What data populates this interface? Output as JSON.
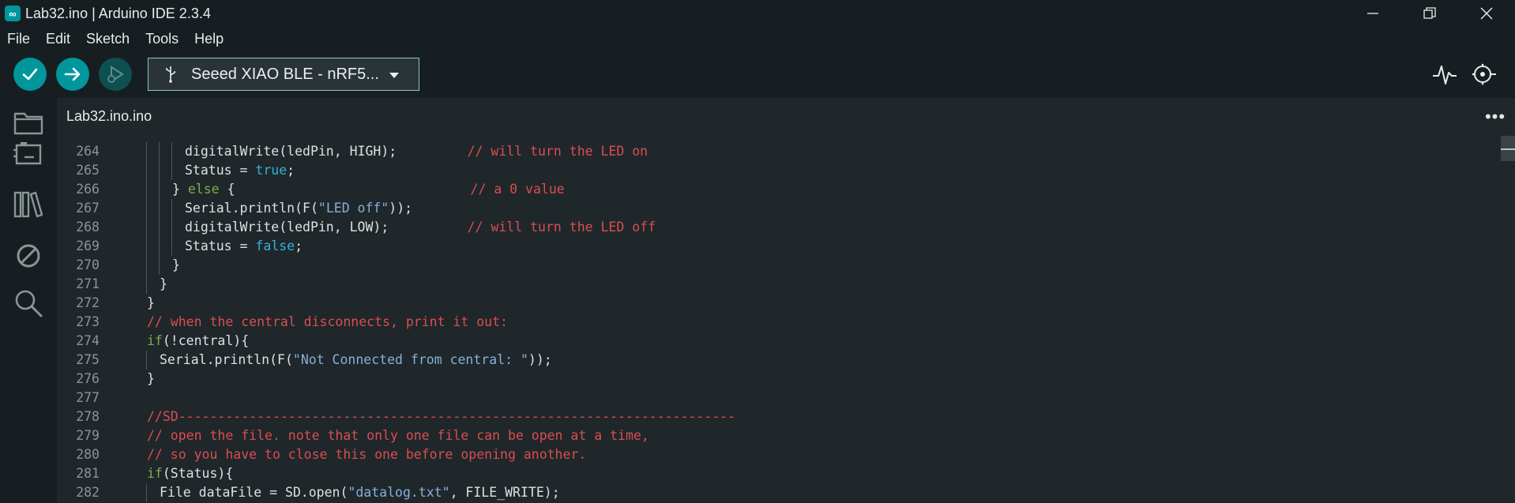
{
  "window": {
    "title": "Lab32.ino | Arduino IDE 2.3.4",
    "app_icon": "arduino-infinity-icon",
    "controls": [
      "minimize",
      "maximize",
      "close"
    ]
  },
  "menu": {
    "items": [
      "File",
      "Edit",
      "Sketch",
      "Tools",
      "Help"
    ]
  },
  "toolbar": {
    "verify_icon": "check-icon",
    "upload_icon": "arrow-right-icon",
    "debug_icon": "debug-icon",
    "board_label": "Seeed XIAO BLE - nRF5...",
    "board_icon": "usb-icon",
    "serial_plotter_icon": "plotter-icon",
    "serial_monitor_icon": "serial-monitor-icon",
    "accent_color": "#00979c"
  },
  "activity_bar": {
    "items": [
      "folder-icon",
      "board-manager-icon",
      "library-icon",
      "debug-disabled-icon",
      "search-icon"
    ]
  },
  "editor": {
    "tab_label": "Lab32.ino.ino",
    "more_label": "•••",
    "lines": [
      {
        "n": "264",
        "indent": 3,
        "parts": [
          [
            "",
            "digitalWrite(ledPin, HIGH);         "
          ],
          [
            "tk-comment",
            "// will turn the LED on"
          ]
        ]
      },
      {
        "n": "265",
        "indent": 3,
        "parts": [
          [
            "",
            "Status = "
          ],
          [
            "tk-const",
            "true"
          ],
          [
            "",
            ";"
          ]
        ]
      },
      {
        "n": "266",
        "indent": 2,
        "parts": [
          [
            "",
            "} "
          ],
          [
            "tk-kw",
            "else"
          ],
          [
            "",
            " {                              "
          ],
          [
            "tk-comment",
            "// a 0 value"
          ]
        ]
      },
      {
        "n": "267",
        "indent": 3,
        "parts": [
          [
            "",
            "Serial.println(F("
          ],
          [
            "tk-str",
            "\"LED off\""
          ],
          [
            "",
            "));"
          ]
        ]
      },
      {
        "n": "268",
        "indent": 3,
        "parts": [
          [
            "",
            "digitalWrite(ledPin, LOW);          "
          ],
          [
            "tk-comment",
            "// will turn the LED off"
          ]
        ]
      },
      {
        "n": "269",
        "indent": 3,
        "parts": [
          [
            "",
            "Status = "
          ],
          [
            "tk-const",
            "false"
          ],
          [
            "",
            ";"
          ]
        ]
      },
      {
        "n": "270",
        "indent": 2,
        "parts": [
          [
            "",
            "}"
          ]
        ]
      },
      {
        "n": "271",
        "indent": 1,
        "parts": [
          [
            "",
            "}"
          ]
        ]
      },
      {
        "n": "272",
        "indent": 0,
        "parts": [
          [
            "",
            "}"
          ]
        ]
      },
      {
        "n": "273",
        "indent": 0,
        "parts": [
          [
            "tk-comment",
            "// when the central disconnects, print it out:"
          ]
        ]
      },
      {
        "n": "274",
        "indent": 0,
        "parts": [
          [
            "tk-kw",
            "if"
          ],
          [
            "",
            "(!central){"
          ]
        ]
      },
      {
        "n": "275",
        "indent": 1,
        "parts": [
          [
            "",
            "Serial.println(F("
          ],
          [
            "tk-str",
            "\"Not Connected from central: \""
          ],
          [
            "",
            "));"
          ]
        ]
      },
      {
        "n": "276",
        "indent": 0,
        "parts": [
          [
            "",
            "}"
          ]
        ]
      },
      {
        "n": "277",
        "indent": 0,
        "parts": []
      },
      {
        "n": "278",
        "indent": 0,
        "parts": [
          [
            "tk-comment",
            "//SD-----------------------------------------------------------------------"
          ]
        ]
      },
      {
        "n": "279",
        "indent": 0,
        "parts": [
          [
            "tk-comment",
            "// open the file. note that only one file can be open at a time,"
          ]
        ]
      },
      {
        "n": "280",
        "indent": 0,
        "parts": [
          [
            "tk-comment",
            "// so you have to close this one before opening another."
          ]
        ]
      },
      {
        "n": "281",
        "indent": 0,
        "parts": [
          [
            "tk-kw",
            "if"
          ],
          [
            "",
            "(Status){"
          ]
        ]
      },
      {
        "n": "282",
        "indent": 1,
        "parts": [
          [
            "",
            "File dataFile = SD.open("
          ],
          [
            "tk-str",
            "\"datalog.txt\""
          ],
          [
            "",
            ", FILE_WRITE);"
          ]
        ]
      }
    ]
  }
}
